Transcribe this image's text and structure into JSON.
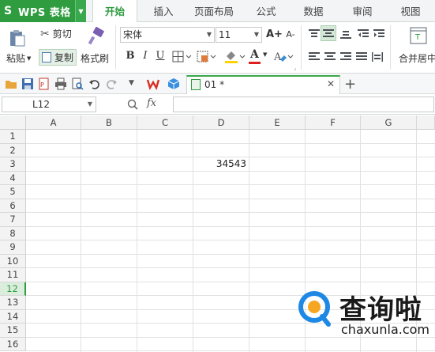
{
  "app": {
    "name": "WPS 表格",
    "logo_letter": "S"
  },
  "tabs": [
    "开始",
    "插入",
    "页面布局",
    "公式",
    "数据",
    "审阅",
    "视图"
  ],
  "active_tab": "开始",
  "ribbon": {
    "cut_label": "剪切",
    "paste_label": "粘贴",
    "copy_label": "复制",
    "format_painter_label": "格式刷",
    "font_name": "宋体",
    "font_size": "11",
    "bold": "B",
    "italic": "I",
    "underline": "U",
    "grow_font": "A+",
    "shrink_font": "A-",
    "font_color_glyph": "A",
    "merge_label": "合并居中"
  },
  "doc_tab": {
    "name": "01 *"
  },
  "formula_bar": {
    "cell_ref": "L12",
    "fx": "fx",
    "value": ""
  },
  "grid": {
    "columns": [
      "A",
      "B",
      "C",
      "D",
      "E",
      "F",
      "G"
    ],
    "rows": [
      "1",
      "2",
      "3",
      "4",
      "5",
      "6",
      "7",
      "8",
      "9",
      "10",
      "11",
      "12",
      "13",
      "14",
      "15",
      "16"
    ],
    "selected_row": "12",
    "cells": [
      {
        "ref": "D3",
        "value": "34543"
      }
    ]
  },
  "watermark": {
    "brand": "查询啦",
    "url": "chaxunla.com"
  },
  "colors": {
    "accent": "#2e9c3f",
    "font_color": "#e02020",
    "highlight": "#ffd200",
    "watermark_blue": "#1e88e5",
    "watermark_orange": "#f5a623"
  }
}
